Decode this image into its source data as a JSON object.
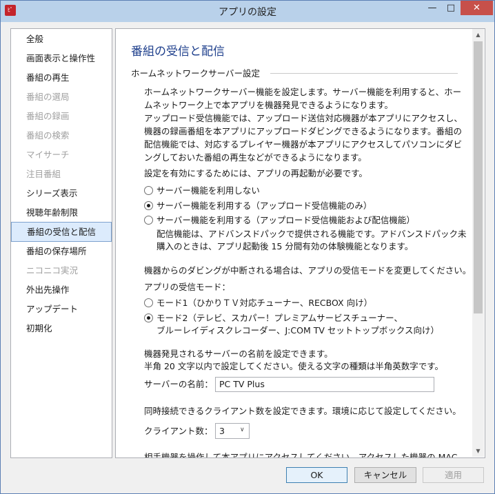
{
  "window": {
    "title": "アプリの設定",
    "icon_text": "ﾋﾟ"
  },
  "sidebar": {
    "items": [
      {
        "label": "全般",
        "state": "enabled"
      },
      {
        "label": "画面表示と操作性",
        "state": "enabled"
      },
      {
        "label": "番組の再生",
        "state": "enabled"
      },
      {
        "label": "番組の選局",
        "state": "disabled"
      },
      {
        "label": "番組の録画",
        "state": "disabled"
      },
      {
        "label": "番組の検索",
        "state": "disabled"
      },
      {
        "label": "マイサーチ",
        "state": "disabled"
      },
      {
        "label": "注目番組",
        "state": "disabled"
      },
      {
        "label": "シリーズ表示",
        "state": "enabled"
      },
      {
        "label": "視聴年齢制限",
        "state": "enabled"
      },
      {
        "label": "番組の受信と配信",
        "state": "selected"
      },
      {
        "label": "番組の保存場所",
        "state": "enabled"
      },
      {
        "label": "ニコニコ実況",
        "state": "disabled"
      },
      {
        "label": "外出先操作",
        "state": "enabled"
      },
      {
        "label": "アップデート",
        "state": "enabled"
      },
      {
        "label": "初期化",
        "state": "enabled"
      }
    ]
  },
  "main": {
    "heading": "番組の受信と配信",
    "section_title": "ホームネットワークサーバー設定",
    "description": [
      "ホームネットワークサーバー機能を設定します。サーバー機能を利用すると、ホー",
      "ムネットワーク上で本アプリを機器発見できるようになります。",
      "アップロード受信機能では、アップロード送信対応機器が本アプリにアクセスし、",
      "機器の録画番組を本アプリにアップロードダビングできるようになります。番組の",
      "配信機能では、対応するプレイヤー機器が本アプリにアクセスしてパソコンにダビ",
      "ングしておいた番組の再生などができるようになります。"
    ],
    "restart_note": "設定を有効にするためには、アプリの再起動が必要です。",
    "server_options": [
      {
        "label": "サーバー機能を利用しない",
        "selected": false
      },
      {
        "label": "サーバー機能を利用する（アップロード受信機能のみ）",
        "selected": true
      },
      {
        "label": "サーバー機能を利用する（アップロード受信機能および配信機能）",
        "selected": false
      }
    ],
    "advanced_note": [
      "配信機能は、アドバンスドパックで提供される機能です。アドバンスドパック未",
      "購入のときは、アプリ起動後 15 分間有効の体験機能となります。"
    ],
    "dubbing_note": "機器からのダビングが中断される場合は、アプリの受信モードを変更してください。",
    "mode_label": "アプリの受信モード：",
    "modes": [
      {
        "label": "モード1（ひかりＴＶ対応チューナー、RECBOX 向け）",
        "selected": false
      },
      {
        "label": "モード2（テレビ、スカパー！プレミアムサービスチューナー、",
        "label2": "ブルーレイディスクレコーダー、J:COM TV セットトップボックス向け）",
        "selected": true
      }
    ],
    "name_desc": [
      "機器発見されるサーバーの名前を設定できます。",
      "半角 20 文字以内で設定してください。使える文字の種類は半角英数字です。"
    ],
    "server_name_label": "サーバーの名前：",
    "server_name_value": "PC TV Plus",
    "clients_desc": "同時接続できるクライアント数を設定できます。環境に応じて設定してください。",
    "clients_label": "クライアント数：",
    "clients_value": "3",
    "cutoff_text": "相手機器を操作して本アプリにアクセスしてください。アクセスした機器の MAC"
  },
  "footer": {
    "ok_label": "OK",
    "cancel_label": "キャンセル",
    "apply_label": "適用"
  }
}
